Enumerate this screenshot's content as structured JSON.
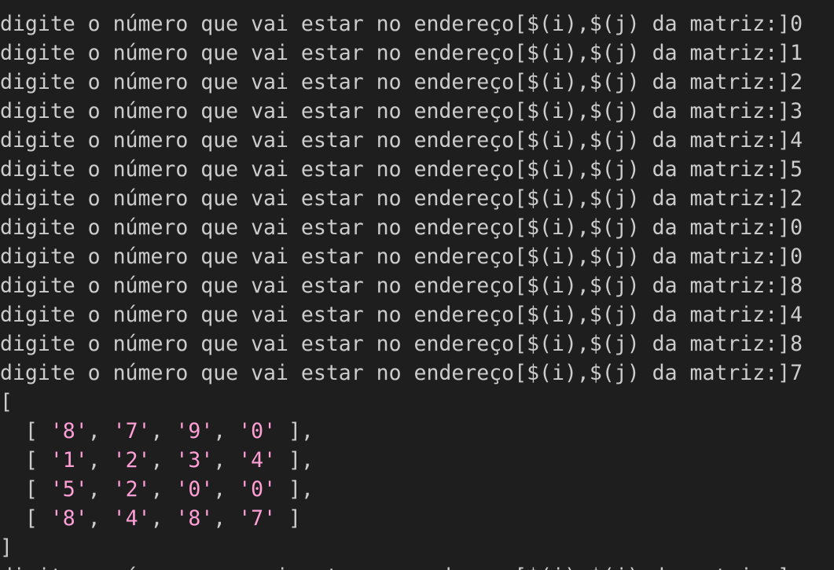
{
  "terminal": {
    "prompt_text": "digite o número que vai estar no endereço[$(i),$(j) da matriz:]",
    "inputs": [
      "0",
      "1",
      "2",
      "3",
      "4",
      "5",
      "2",
      "0",
      "0",
      "8",
      "4",
      "8",
      "7"
    ],
    "open_bracket": "[",
    "close_bracket": "]",
    "matrix": [
      [
        "'8'",
        "'7'",
        "'9'",
        "'0'"
      ],
      [
        "'1'",
        "'2'",
        "'3'",
        "'4'"
      ],
      [
        "'5'",
        "'2'",
        "'0'",
        "'0'"
      ],
      [
        "'8'",
        "'4'",
        "'8'",
        "'7'"
      ]
    ]
  }
}
